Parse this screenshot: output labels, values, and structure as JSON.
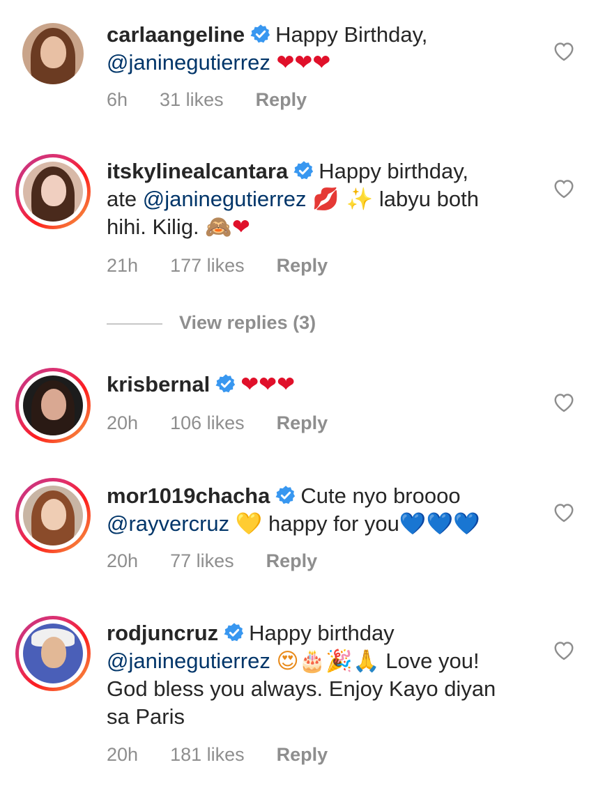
{
  "comments": [
    {
      "username": "carlaangeline",
      "text_before": "Happy Birthday,",
      "mention": "@janinegutierrez",
      "text_after": "",
      "emojis": "❤❤❤",
      "time": "6h",
      "likes": "31 likes",
      "reply": "Reply"
    },
    {
      "username": "itskylinealcantara",
      "text_before": "Happy birthday,",
      "line2_prefix": "ate",
      "mention": "@janinegutierrez",
      "emojis_mid": "💋 ✨",
      "text_after": "labyu both",
      "line3": "hihi. Kilig.",
      "emojis_end": "🙈❤",
      "time": "21h",
      "likes": "177 likes",
      "reply": "Reply"
    },
    {
      "username": "krisbernal",
      "emojis": "❤❤❤",
      "time": "20h",
      "likes": "106 likes",
      "reply": "Reply"
    },
    {
      "username": "mor1019chacha",
      "text_before": "Cute nyo broooo",
      "mention": "@rayvercruz",
      "emoji_mid": "💛",
      "text_after": "happy for you",
      "emojis_end": "💙💙💙",
      "time": "20h",
      "likes": "77 likes",
      "reply": "Reply"
    },
    {
      "username": "rodjuncruz",
      "text_before": "Happy birthday",
      "mention": "@janinegutierrez",
      "emojis_mid": "😍🎂🎉🙏",
      "text_after": "Love you!",
      "line3": "God bless you always. Enjoy Kayo diyan",
      "line4": "sa Paris",
      "time": "20h",
      "likes": "181 likes",
      "reply": "Reply"
    }
  ],
  "view_replies": "View replies (3)",
  "colors": {
    "text": "#262626",
    "meta": "#8e8e8e",
    "mention": "#003569",
    "verified": "#3897f0",
    "heart_red": "#e0102a",
    "heart_blue": "#1e88e5"
  },
  "icons": {
    "verified": "verified-badge-icon",
    "like": "heart-outline-icon"
  }
}
